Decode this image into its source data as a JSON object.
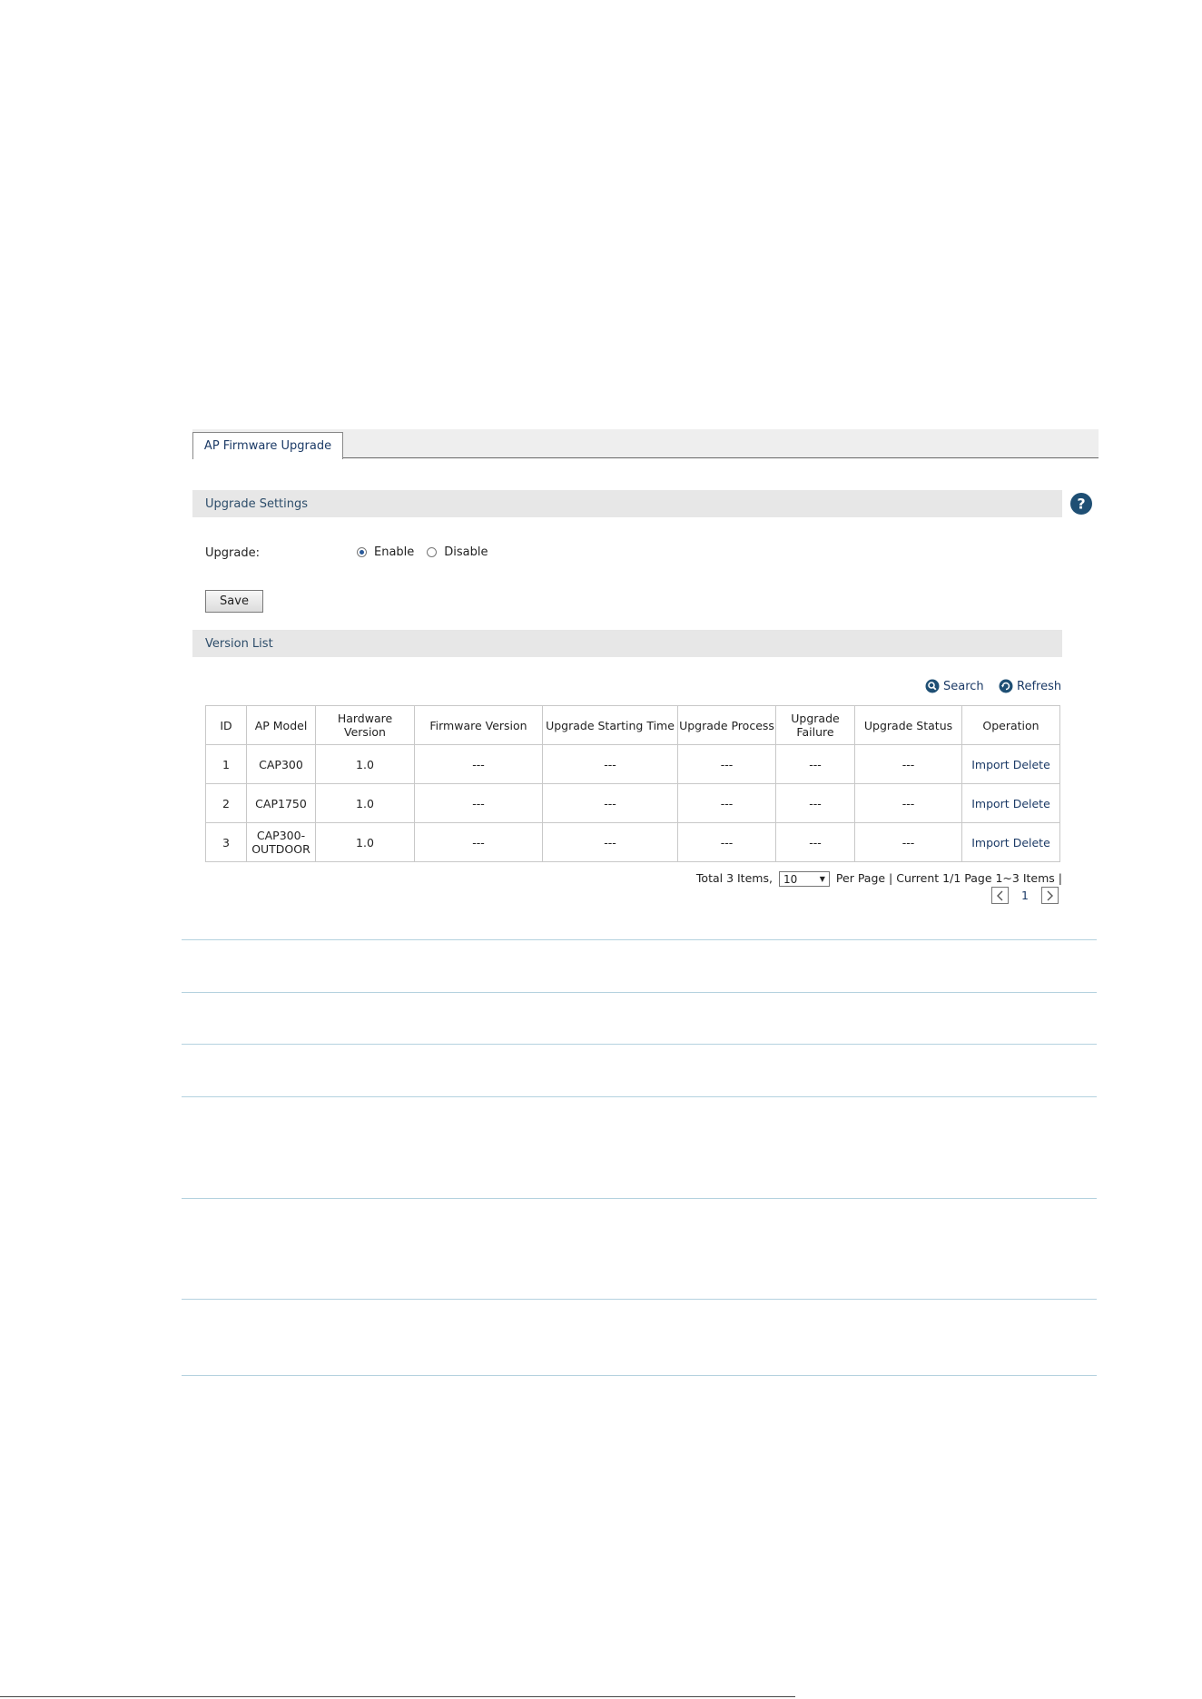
{
  "tab": {
    "label": "AP Firmware Upgrade"
  },
  "settings": {
    "header": "Upgrade Settings",
    "upgrade_label": "Upgrade:",
    "options": [
      {
        "label": "Enable",
        "selected": true
      },
      {
        "label": "Disable",
        "selected": false
      }
    ],
    "save_label": "Save"
  },
  "version_list": {
    "header": "Version List",
    "search_label": "Search",
    "refresh_label": "Refresh",
    "columns": [
      "ID",
      "AP Model",
      "Hardware Version",
      "Firmware Version",
      "Upgrade Starting Time",
      "Upgrade Process",
      "Upgrade Failure",
      "Upgrade Status",
      "Operation"
    ],
    "rows": [
      {
        "id": "1",
        "model": "CAP300",
        "hardware": "1.0",
        "firmware": "---",
        "start_time": "---",
        "process": "---",
        "failure": "---",
        "status": "---",
        "import": "Import",
        "delete": "Delete"
      },
      {
        "id": "2",
        "model": "CAP1750",
        "hardware": "1.0",
        "firmware": "---",
        "start_time": "---",
        "process": "---",
        "failure": "---",
        "status": "---",
        "import": "Import",
        "delete": "Delete"
      },
      {
        "id": "3",
        "model": "CAP300-OUTDOOR",
        "hardware": "1.0",
        "firmware": "---",
        "start_time": "---",
        "process": "---",
        "failure": "---",
        "status": "---",
        "import": "Import",
        "delete": "Delete"
      }
    ]
  },
  "pagination": {
    "total_text": "Total 3 Items,",
    "per_page_value": "10",
    "per_page_text": "Per Page | Current 1/1 Page 1~3 Items |",
    "page_number": "1"
  },
  "colors": {
    "link": "#1b3a66",
    "section_bg": "#e7e7e7",
    "divider": "#b4d2df"
  }
}
